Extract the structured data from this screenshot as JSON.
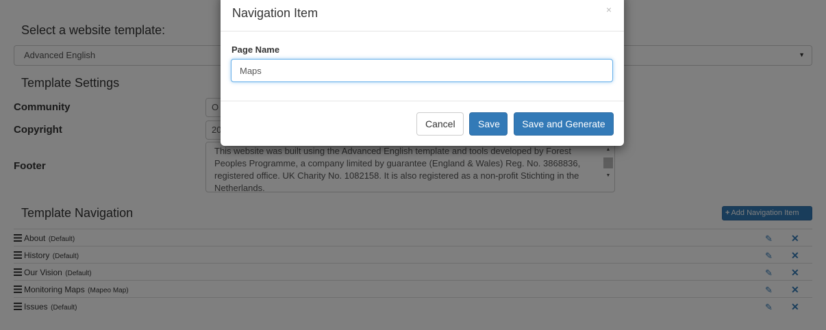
{
  "page": {
    "select_template_heading": "Select a website template:",
    "selected_template": "Advanced English",
    "template_settings_heading": "Template Settings",
    "fields": {
      "community_label": "Community",
      "community_value": "O",
      "copyright_label": "Copyright",
      "copyright_value": "20",
      "footer_label": "Footer",
      "footer_value": "This website was built using the Advanced English template and tools developed by Forest Peoples Programme, a company limited by guarantee (England & Wales) Reg. No. 3868836, registered office. UK Charity No. 1082158. It is also registered as a non-profit Stichting in the Netherlands."
    },
    "template_navigation_heading": "Template Navigation",
    "add_navigation_label": "Add Navigation Item",
    "nav_items": [
      {
        "name": "About",
        "tag": "(Default)"
      },
      {
        "name": "History",
        "tag": "(Default)"
      },
      {
        "name": "Our Vision",
        "tag": "(Default)"
      },
      {
        "name": "Monitoring Maps",
        "tag": "(Mapeo Map)"
      },
      {
        "name": "Issues",
        "tag": "(Default)"
      }
    ]
  },
  "modal": {
    "title": "Navigation Item",
    "close_glyph": "×",
    "page_name_label": "Page Name",
    "page_name_value": "Maps",
    "cancel_label": "Cancel",
    "save_label": "Save",
    "save_generate_label": "Save and Generate"
  },
  "icons": {
    "menu": "hamburger-icon",
    "edit": "pencil-icon",
    "delete": "close-icon",
    "add": "plus-icon"
  },
  "colors": {
    "primary": "#337ab7",
    "overlay": "rgba(0,0,0,0.5)",
    "focus_border": "#66afe9"
  }
}
